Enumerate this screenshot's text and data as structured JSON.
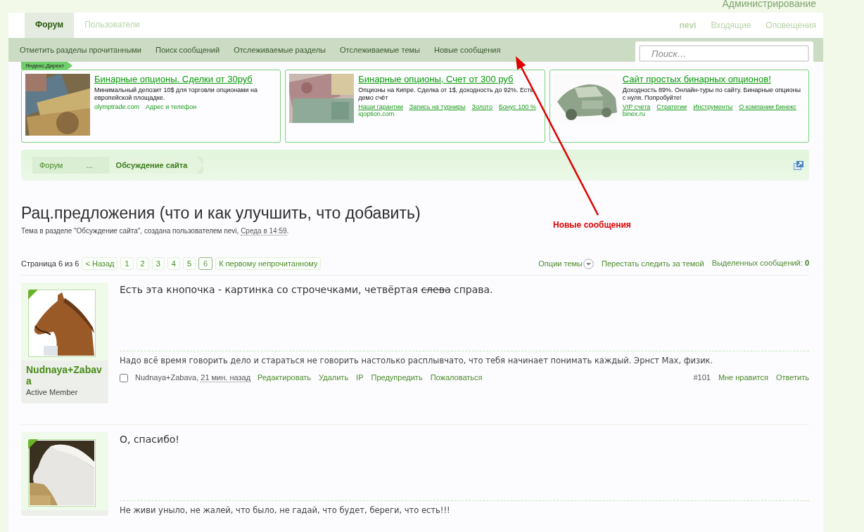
{
  "admin_link": "Администрирование",
  "tabs": [
    {
      "label": "Форум",
      "selected": true
    },
    {
      "label": "Пользователи",
      "selected": false
    }
  ],
  "user_links": [
    {
      "label": "nevi",
      "kind": "user"
    },
    {
      "label": "Входящие",
      "kind": "link"
    },
    {
      "label": "Оповещения",
      "kind": "link"
    }
  ],
  "subnav": [
    "Отметить разделы прочитанными",
    "Поиск сообщений",
    "Отслеживаемые разделы",
    "Отслеживаемые темы",
    "Новые сообщения"
  ],
  "search": {
    "placeholder": "Поиск…"
  },
  "ads": {
    "label": "Яндекс.Директ",
    "items": [
      {
        "title": "Бинарные опционы. Сделки от 30руб",
        "text": "Минимальный депозит 10$ для торговли опционами на европейской площадке.",
        "links": [
          "olymptrade.com",
          "Адрес и телефон"
        ],
        "underline": false
      },
      {
        "title": "Бинарные опционы, Счет от 300 руб",
        "text": "Опционы на Кипре. Сделка от 1$, доходность до 92%. Есть демо счёт",
        "links": [
          "Наши гарантии",
          "Запись на турниры",
          "Золото",
          "Бонус 100 %"
        ],
        "underline": true,
        "domain": "iqoption.com"
      },
      {
        "title": "Сайт простых бинарных опционов!",
        "text": "Доходность 89%. Онлайн-туры по сайту. Бинарные опционы с нуля. Попробуйте!",
        "links": [
          "VIP счета",
          "Стратегии",
          "Инструменты",
          "О компании Бинекс"
        ],
        "underline": true,
        "domain": "binex.ru"
      }
    ]
  },
  "breadcrumb": [
    {
      "label": "Форум",
      "current": false
    },
    {
      "label": "...",
      "current": false
    },
    {
      "label": "Обсуждение сайта",
      "current": true
    }
  ],
  "title": "Рац.предложения (что и как улучшить, что добавить)",
  "meta": {
    "text": "Тема в разделе \"Обсуждение сайта\", создана пользователем nevi, ",
    "date": "Среда в 14:59",
    "end": "."
  },
  "pagination": {
    "label": "Страница 6 из 6",
    "prev": "< Назад",
    "pages": [
      {
        "label": "1",
        "selected": false
      },
      {
        "label": "2",
        "selected": false
      },
      {
        "label": "3",
        "selected": false
      },
      {
        "label": "4",
        "selected": false
      },
      {
        "label": "5",
        "selected": false
      },
      {
        "label": "6",
        "selected": true
      }
    ],
    "first_unread": "К первому непрочитанному"
  },
  "thread_tools": {
    "options": "Опции темы",
    "unwatch": "Перестать следить за темой",
    "selected_count": "Выделенных сообщений: **0**"
  },
  "posts": [
    {
      "username": "Nudnaya+Zabava",
      "user_title": "Active Member",
      "avatar": {
        "kind": "picture"
      },
      "message": [
        {
          "text": "Есть эта кнопочка - картинка со строчечками, четвёртая ",
          "strike": false
        },
        {
          "text": "слева",
          "strike": true
        },
        {
          "text": " справа.",
          "strike": false
        }
      ],
      "signature": "Надо всё время говорить дело и стараться не говорить настолько расплывчато, что тебя начинает понимать каждый. Эрнст Мах, физик.",
      "footer": {
        "checked": false,
        "author": "Nudnaya+Zabava, ",
        "time": "21 мин. назад",
        "actions": [
          "Редактировать",
          "Удалить",
          "IP",
          "Предупредить",
          "Пожаловаться"
        ],
        "number": "#101",
        "like": "Мне нравится",
        "reply": "Ответить"
      }
    },
    {
      "avatar": {
        "kind": "picture"
      },
      "message": [
        {
          "text": "О, спасибо!",
          "strike": false
        }
      ],
      "signature": "Не живи уныло, не жалей, что было, не гадай, что будет, береги, что есть!!!"
    }
  ],
  "annotation": {
    "label": "Новые сообщения"
  }
}
